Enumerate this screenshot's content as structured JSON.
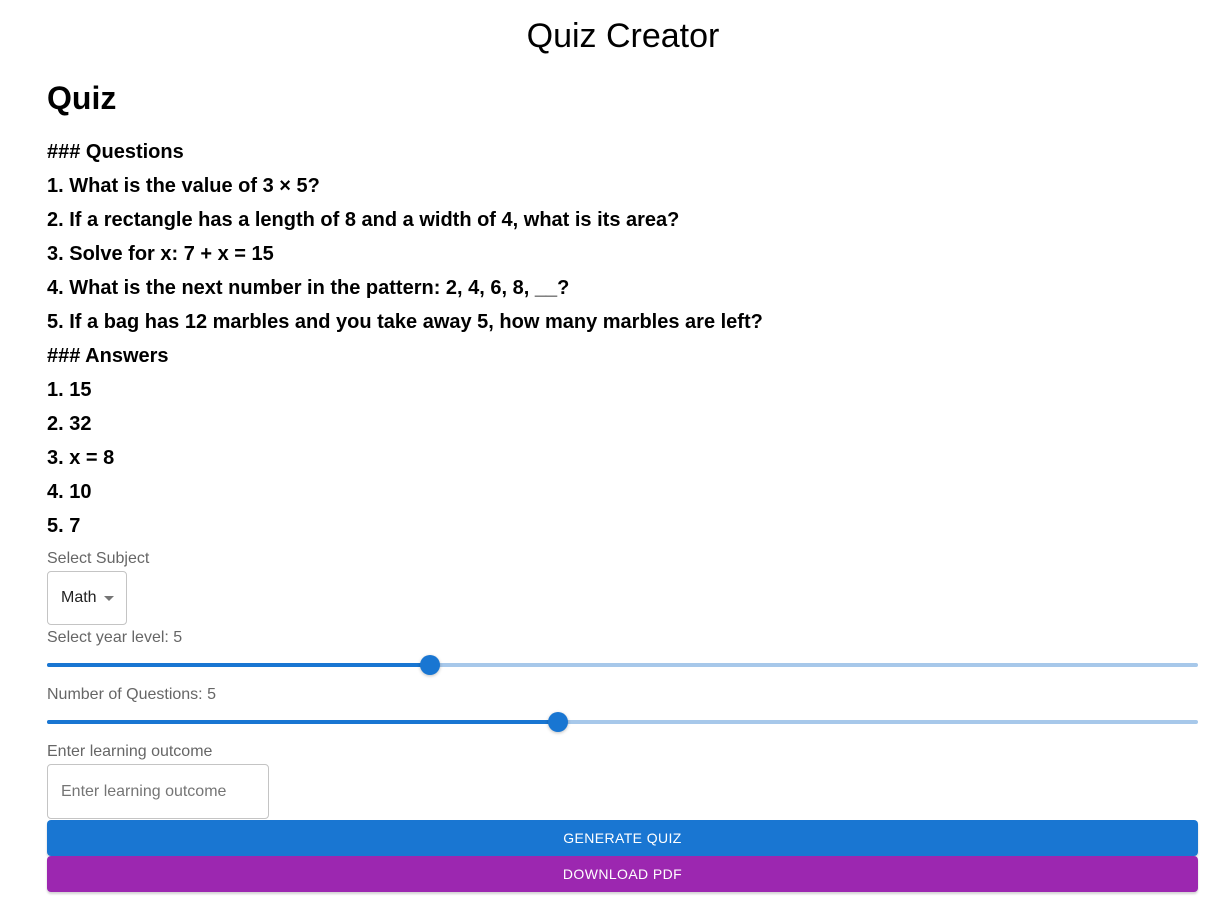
{
  "app": {
    "title": "Quiz Creator"
  },
  "quiz": {
    "heading": "Quiz",
    "lines": [
      "### Questions",
      "1. What is the value of 3 × 5?",
      "2. If a rectangle has a length of 8 and a width of 4, what is its area?",
      "3. Solve for x: 7 + x = 15",
      "4. What is the next number in the pattern: 2, 4, 6, 8, __?",
      "5. If a bag has 12 marbles and you take away 5, how many marbles are left?",
      "### Answers",
      "1. 15",
      "2. 32",
      "3. x = 8",
      "4. 10",
      "5. 7"
    ]
  },
  "form": {
    "subject": {
      "label": "Select Subject",
      "value": "Math"
    },
    "year_level": {
      "label": "Select year level: 5",
      "fraction": 0.333
    },
    "num_questions": {
      "label": "Number of Questions: 5",
      "fraction": 0.444
    },
    "learning_outcome": {
      "label": "Enter learning outcome",
      "placeholder": "Enter learning outcome",
      "value": ""
    }
  },
  "buttons": {
    "generate_label": "GENERATE QUIZ",
    "download_label": "DOWNLOAD PDF"
  },
  "colors": {
    "primary": "#1976d2",
    "secondary": "#9c27b0",
    "rail": "#a7c8ea"
  }
}
